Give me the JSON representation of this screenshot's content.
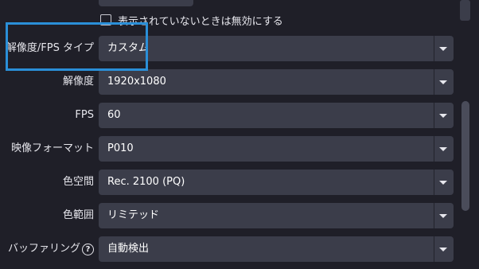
{
  "checkbox": {
    "label": "表示されていないときは無効にする",
    "checked": false
  },
  "rows": [
    {
      "label": "解像度/FPS タイプ",
      "value": "カスタム"
    },
    {
      "label": "解像度",
      "value": "1920x1080"
    },
    {
      "label": "FPS",
      "value": "60"
    },
    {
      "label": "映像フォーマット",
      "value": "P010"
    },
    {
      "label": "色空間",
      "value": "Rec. 2100 (PQ)"
    },
    {
      "label": "色範囲",
      "value": "リミテッド"
    },
    {
      "label": "バッファリング",
      "value": "自動検出",
      "help_icon": "?"
    }
  ],
  "colors": {
    "highlight": "#2a8fd8",
    "field_bg": "#3b3d4a",
    "panel_bg": "#1f1f28"
  }
}
